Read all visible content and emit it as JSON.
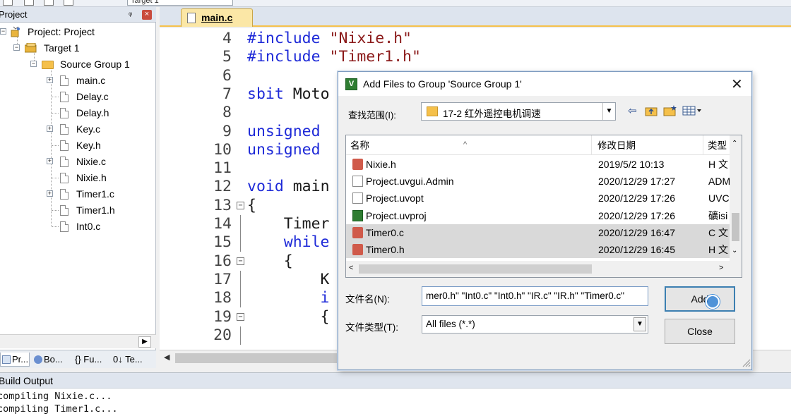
{
  "toolbar": {
    "target": "Target 1"
  },
  "project_panel": {
    "title": "Project",
    "pin": "ᵠ",
    "close": "×",
    "tree": {
      "project": "Project: Project",
      "target": "Target 1",
      "group": "Source Group 1",
      "files": [
        "main.c",
        "Delay.c",
        "Delay.h",
        "Key.c",
        "Key.h",
        "Nixie.c",
        "Nixie.h",
        "Timer1.c",
        "Timer1.h",
        "Int0.c"
      ]
    },
    "tabs": [
      "Pr...",
      "Bo...",
      "{} Fu...",
      "0↓ Te..."
    ]
  },
  "editor": {
    "tab": "main.c",
    "lines": [
      {
        "num": "4",
        "code": [
          [
            "pp",
            "#include "
          ],
          [
            "str",
            "\"Nixie.h\""
          ]
        ]
      },
      {
        "num": "5",
        "code": [
          [
            "pp",
            "#include "
          ],
          [
            "str",
            "\"Timer1.h\""
          ]
        ]
      },
      {
        "num": "6",
        "code": []
      },
      {
        "num": "7",
        "code": [
          [
            "kw",
            "sbit "
          ],
          [
            "plain",
            "Moto"
          ]
        ]
      },
      {
        "num": "8",
        "code": []
      },
      {
        "num": "9",
        "code": [
          [
            "kw",
            "unsigned"
          ]
        ]
      },
      {
        "num": "10",
        "code": [
          [
            "kw",
            "unsigned"
          ]
        ]
      },
      {
        "num": "11",
        "code": []
      },
      {
        "num": "12",
        "code": [
          [
            "kw",
            "void "
          ],
          [
            "plain",
            "main"
          ]
        ]
      },
      {
        "num": "13",
        "code": [
          [
            "plain",
            "{"
          ]
        ]
      },
      {
        "num": "14",
        "code": [
          [
            "plain",
            "    Timer"
          ]
        ]
      },
      {
        "num": "15",
        "code": [
          [
            "kw",
            "    while"
          ]
        ]
      },
      {
        "num": "16",
        "code": [
          [
            "plain",
            "    {"
          ]
        ]
      },
      {
        "num": "17",
        "code": [
          [
            "plain",
            "        K"
          ]
        ]
      },
      {
        "num": "18",
        "code": [
          [
            "kw",
            "        i"
          ]
        ]
      },
      {
        "num": "19",
        "code": [
          [
            "plain",
            "        {"
          ]
        ]
      },
      {
        "num": "20",
        "code": []
      }
    ]
  },
  "build_output": {
    "title": "Build Output",
    "lines": [
      "compiling Nixie.c...",
      "compiling Timer1.c..."
    ]
  },
  "dialog": {
    "title": "Add Files to Group 'Source Group 1'",
    "close": "✕",
    "lookin_label": "查找范围(I):",
    "lookin_value": "17-2 红外遥控电机调速",
    "columns": {
      "name": "名称",
      "date": "修改日期",
      "type": "类型"
    },
    "files": [
      {
        "name": "Nixie.h",
        "date": "2019/5/2 10:13",
        "type": "H 文",
        "icon": "h-file-icon",
        "selected": false
      },
      {
        "name": "Project.uvgui.Admin",
        "date": "2020/12/29 17:27",
        "type": "ADM",
        "icon": "text-file-icon",
        "selected": false
      },
      {
        "name": "Project.uvopt",
        "date": "2020/12/29 17:26",
        "type": "UVC",
        "icon": "text-file-icon",
        "selected": false
      },
      {
        "name": "Project.uvproj",
        "date": "2020/12/29 17:26",
        "type": "礦isi",
        "icon": "uvproj-icon",
        "selected": false
      },
      {
        "name": "Timer0.c",
        "date": "2020/12/29 16:47",
        "type": "C 文",
        "icon": "c-file-icon",
        "selected": true
      },
      {
        "name": "Timer0.h",
        "date": "2020/12/29 16:45",
        "type": "H 文",
        "icon": "h-file-icon",
        "selected": true
      }
    ],
    "filename_label": "文件名(N):",
    "filename_value": "mer0.h\" \"Int0.c\" \"Int0.h\" \"IR.c\" \"IR.h\" \"Timer0.c\"",
    "filetype_label": "文件类型(T):",
    "filetype_value": "All files (*.*)",
    "add_button": "Add",
    "close_button": "Close"
  },
  "colors": {
    "keyword": "#1e2ad8",
    "string": "#8b1a1a",
    "tab_accent": "#f5c04a"
  }
}
